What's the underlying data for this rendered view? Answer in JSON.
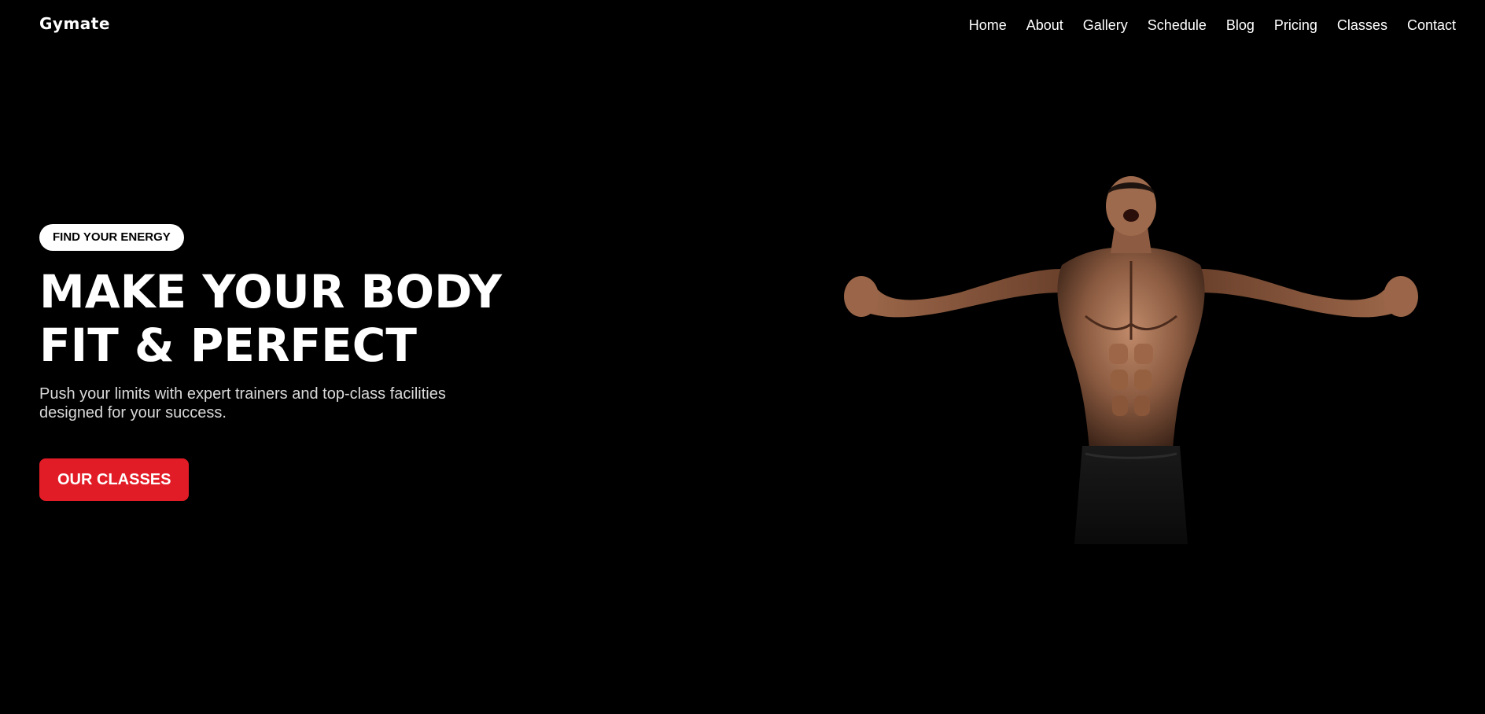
{
  "header": {
    "logo": "Gymate",
    "nav": [
      "Home",
      "About",
      "Gallery",
      "Schedule",
      "Blog",
      "Pricing",
      "Classes",
      "Contact"
    ]
  },
  "hero": {
    "badge": "FIND YOUR ENERGY",
    "headline_line1": "MAKE YOUR BODY",
    "headline_line2": "FIT & PERFECT",
    "subtext": "Push your limits with expert trainers and top-class facilities designed for your success.",
    "cta_label": "OUR CLASSES",
    "image_subject": "muscular man flexing arms"
  },
  "colors": {
    "background": "#000000",
    "accent": "#e21c26",
    "text": "#ffffff",
    "badge_bg": "#ffffff"
  }
}
